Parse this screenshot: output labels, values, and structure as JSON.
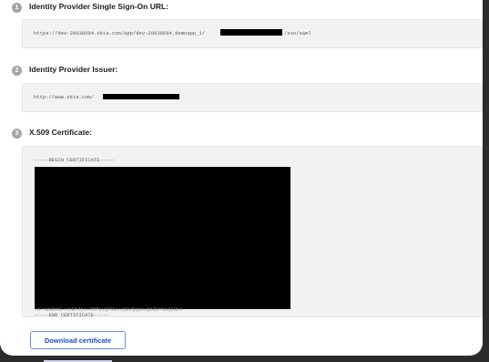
{
  "steps": [
    {
      "number": "1",
      "label": "Identity Provider Single Sign-On URL:",
      "value_prefix": "https://dev-29938694.okta.com/app/dev-29938694_demoapp_1/",
      "value_suffix": "/sso/saml"
    },
    {
      "number": "2",
      "label": "Identity Provider Issuer:",
      "value_prefix": "http://www.okta.com/"
    },
    {
      "number": "3",
      "label": "X.509 Certificate:",
      "cert_begin": "-----BEGIN CERTIFICATE-----",
      "cert_end": "-----END CERTIFICATE-----",
      "cert_fragment": "uFr0mRNnE+v9Eb7pJ+MMf0xQPRwLVpBVQqpKuQ6RUYNaQE8K4"
    }
  ],
  "download_button": {
    "label": "Download certificate"
  },
  "colors": {
    "redaction": "#000000",
    "button_text": "#1b4fc4",
    "button_border": "#6b8fd6",
    "step_badge": "#a4a4a4"
  }
}
